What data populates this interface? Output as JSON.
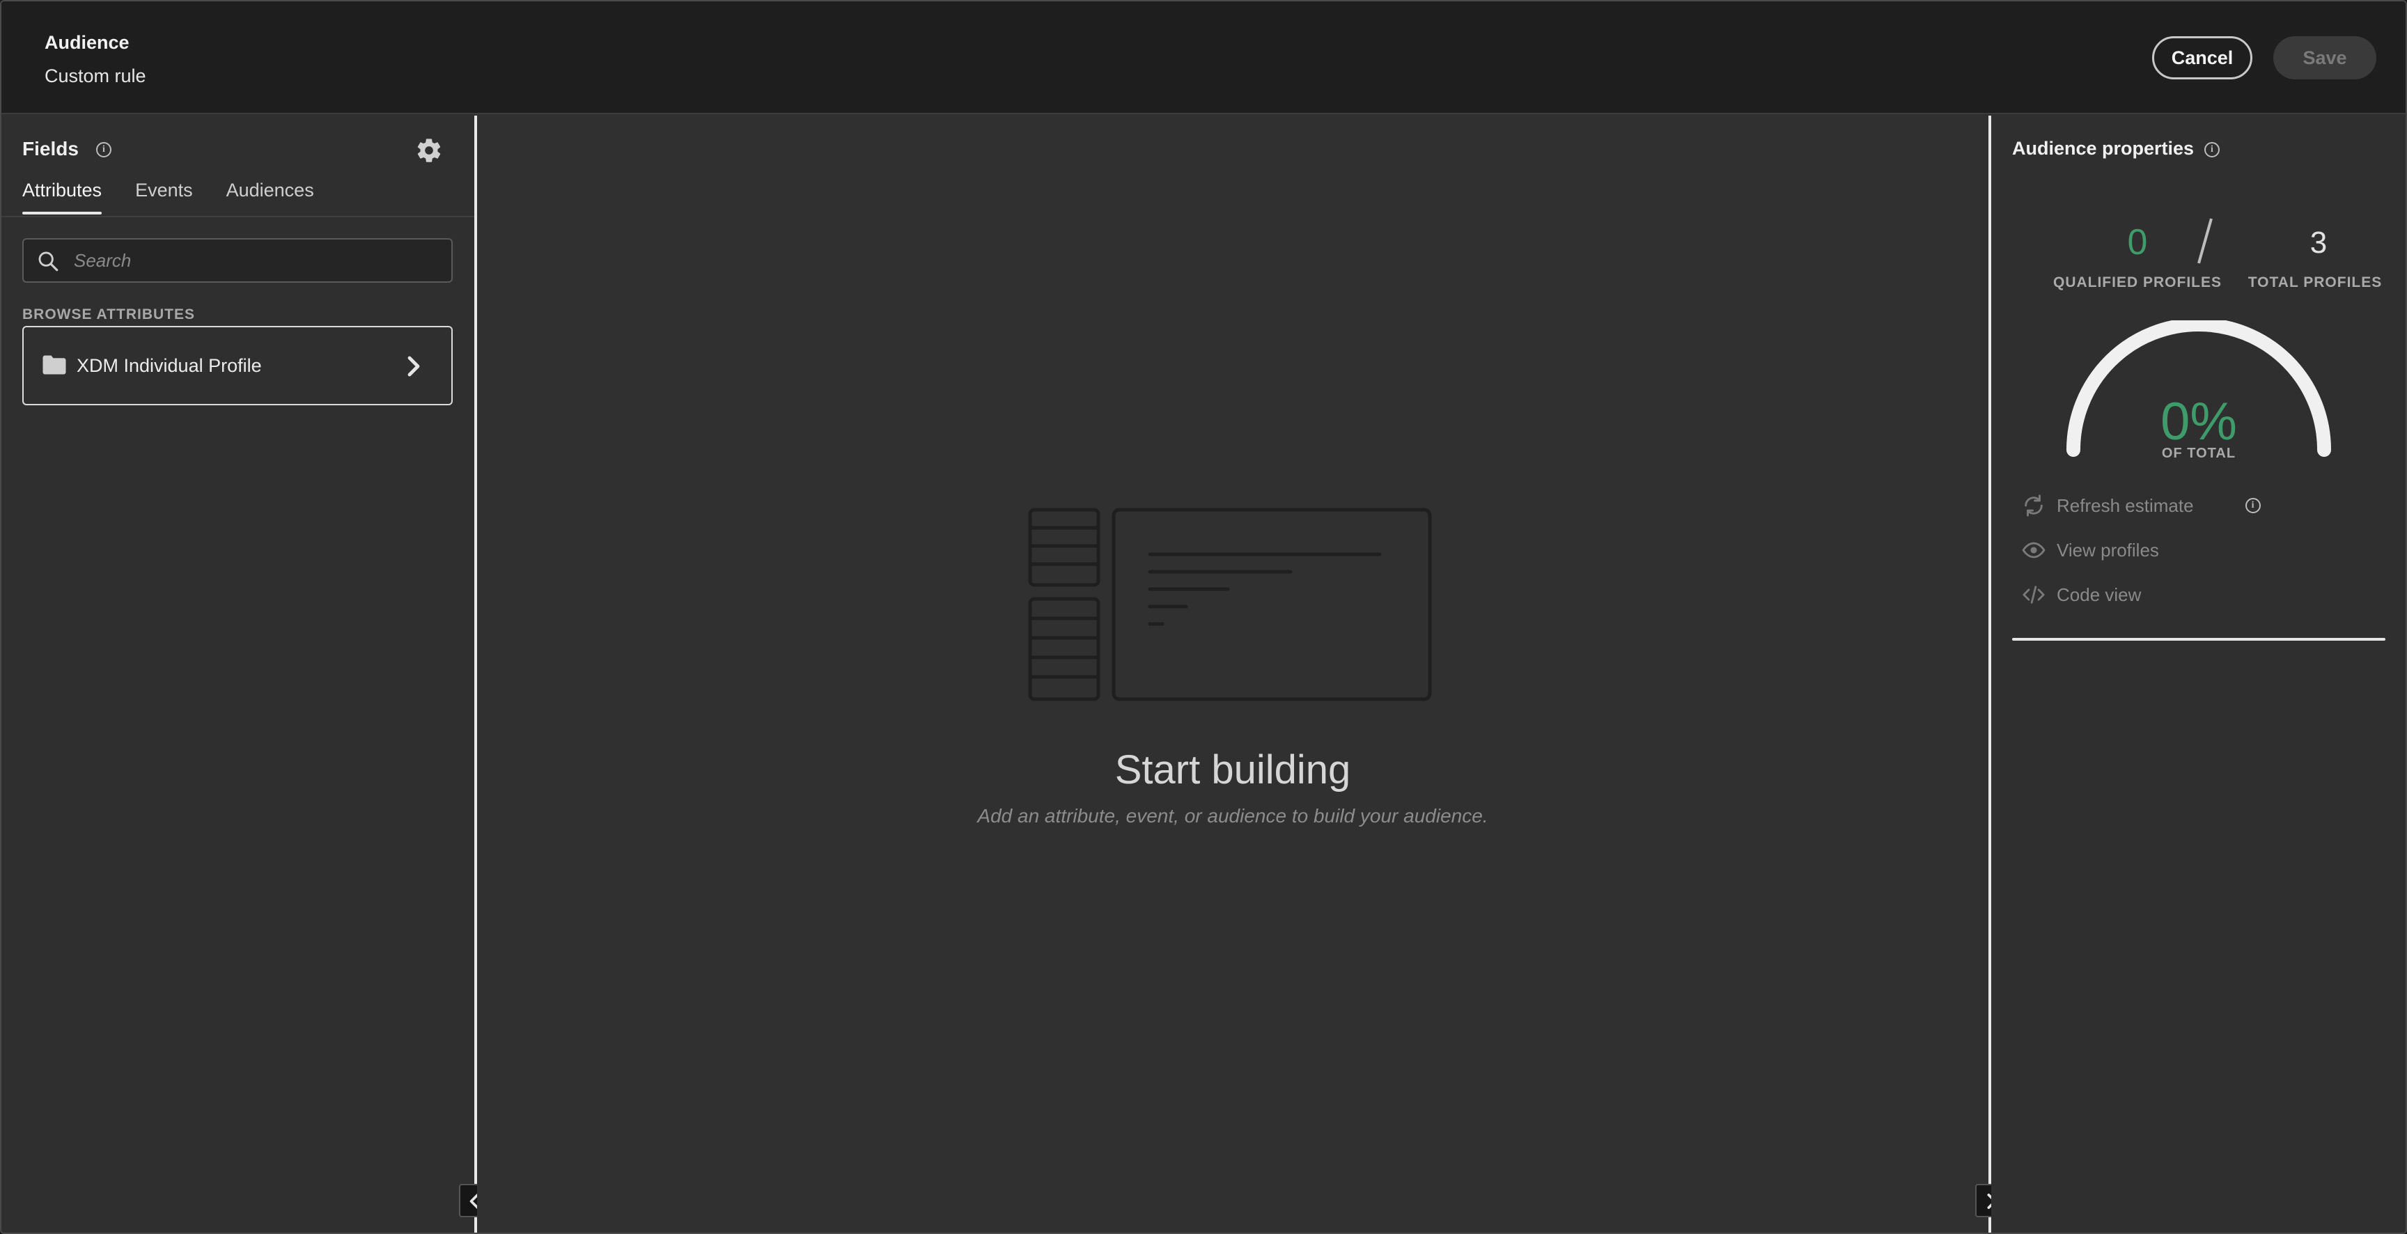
{
  "header": {
    "title": "Audience",
    "subtitle": "Custom rule",
    "cancel_label": "Cancel",
    "save_label": "Save"
  },
  "fields_panel": {
    "title": "Fields",
    "tabs": [
      {
        "label": "Attributes",
        "active": true
      },
      {
        "label": "Events",
        "active": false
      },
      {
        "label": "Audiences",
        "active": false
      }
    ],
    "search_placeholder": "Search",
    "browse_label": "BROWSE ATTRIBUTES",
    "browse_items": [
      {
        "label": "XDM Individual Profile",
        "icon": "folder-icon"
      }
    ]
  },
  "canvas": {
    "empty_title": "Start building",
    "empty_subtitle": "Add an attribute, event, or audience to build your audience."
  },
  "properties_panel": {
    "title": "Audience properties",
    "qualified_profiles": "0",
    "qualified_label": "QUALIFIED PROFILES",
    "total_profiles": "3",
    "total_label": "TOTAL PROFILES",
    "percent": "0%",
    "percent_label": "OF TOTAL",
    "gauge_fraction": 0,
    "actions": [
      {
        "label": "Refresh estimate",
        "icon": "refresh-icon"
      },
      {
        "label": "View profiles",
        "icon": "eye-icon"
      },
      {
        "label": "Code view",
        "icon": "code-icon"
      }
    ]
  },
  "colors": {
    "accent_green": "#3f9b6a",
    "header_bg": "#1e1e1e",
    "panel_bg": "#2f2f2f"
  }
}
